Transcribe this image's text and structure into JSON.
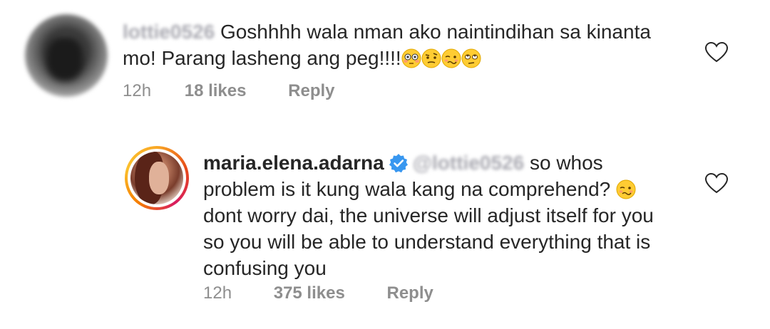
{
  "comments": [
    {
      "username": "lottie0526",
      "text_line1": "Goshhhh wala nman ako naintindihan sa kinanta",
      "text_line2": "mo! Parang lasheng ang peg!!!!",
      "emojis": [
        "flushed-face",
        "face-with-raised-eyebrow",
        "woozy-face",
        "face-with-rolling-eyes"
      ],
      "time": "12h",
      "likes": "18 likes",
      "reply": "Reply"
    },
    {
      "username": "maria.elena.adarna",
      "verified": true,
      "mention": "@lottie0526",
      "text_line1": "so whos",
      "text_line2": "problem is it kung wala kang na comprehend?",
      "emoji": "woozy-face",
      "text_line3": "dont worry dai, the universe will adjust itself for you",
      "text_line4": "so you will be able to understand everything that is",
      "text_line5": "confusing you",
      "time": "12h",
      "likes": "375 likes",
      "reply": "Reply"
    }
  ],
  "colors": {
    "text": "#262626",
    "meta": "#8e8e8e",
    "verified": "#3897f0",
    "emoji": "#ffcc33"
  }
}
